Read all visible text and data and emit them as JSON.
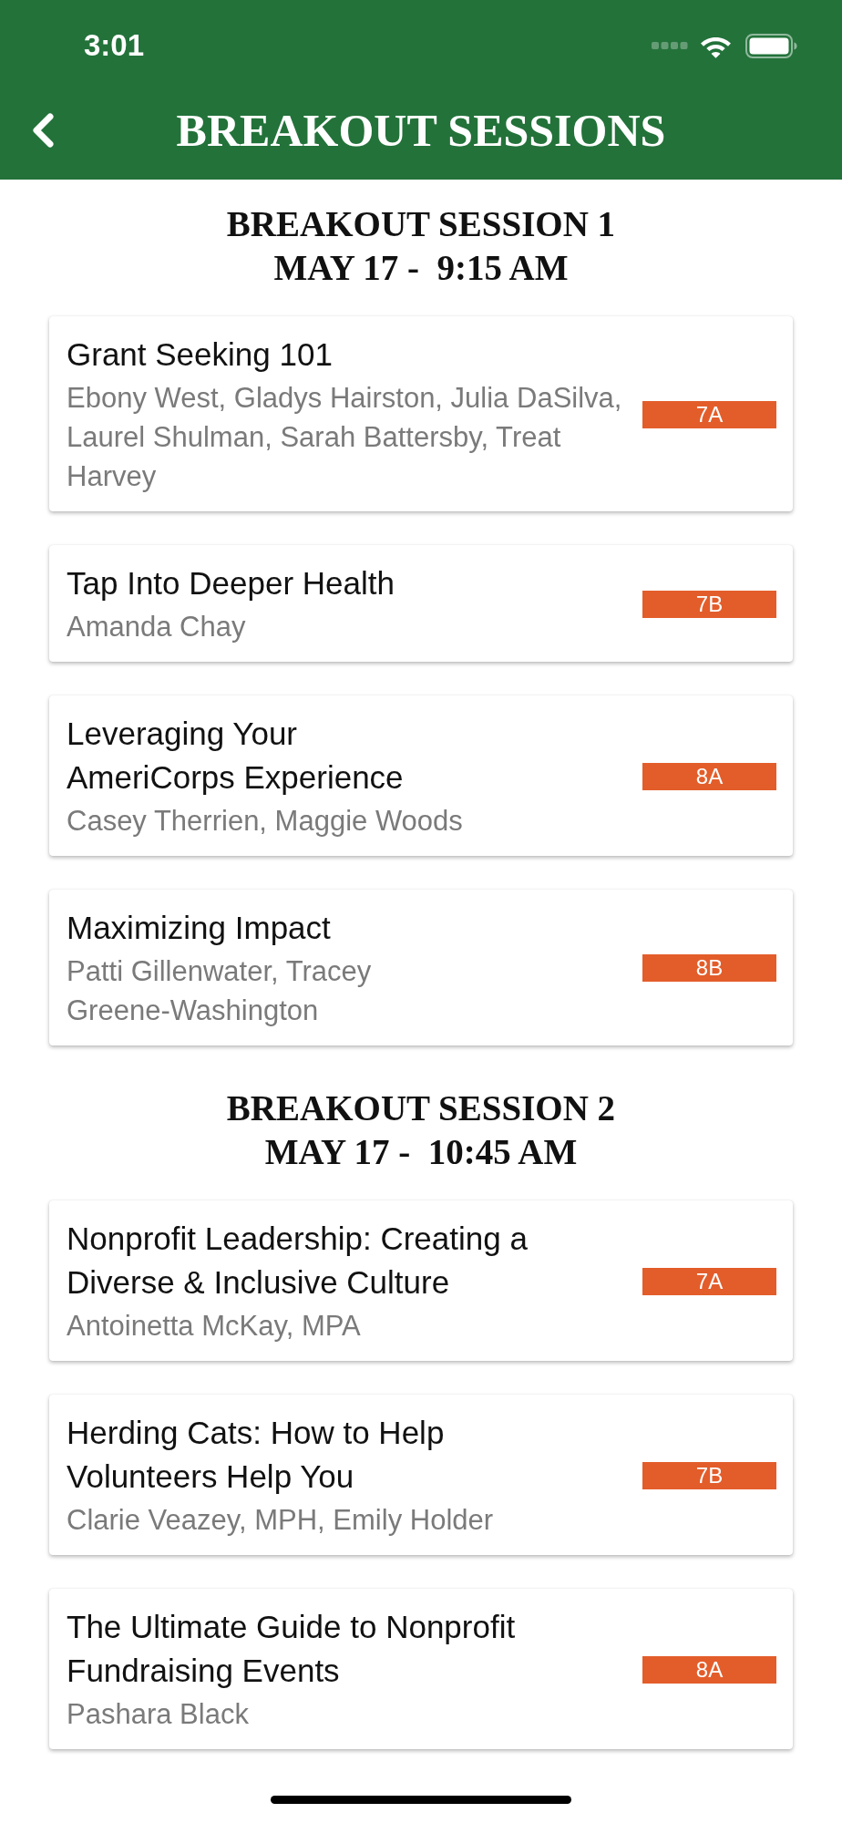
{
  "status_bar": {
    "time": "3:01"
  },
  "nav_bar": {
    "title": "BREAKOUT SESSIONS"
  },
  "sections": [
    {
      "title": "BREAKOUT SESSION 1",
      "time": "MAY 17 -  9:15 AM",
      "sessions": [
        {
          "title": "Grant Seeking 101",
          "speakers": "Ebony West, Gladys Hairston, Julia DaSilva, Laurel Shulman, Sarah Battersby, Treat Harvey",
          "room": "7A"
        },
        {
          "title": "Tap Into Deeper Health",
          "speakers": "Amanda Chay",
          "room": "7B"
        },
        {
          "title": "Leveraging Your\nAmeriCorps Experience",
          "speakers": "Casey Therrien, Maggie Woods",
          "room": "8A"
        },
        {
          "title": "Maximizing Impact",
          "speakers": "Patti Gillenwater, Tracey Greene-Washington",
          "room": "8B"
        }
      ]
    },
    {
      "title": "BREAKOUT SESSION 2",
      "time": "MAY 17 -  10:45 AM",
      "sessions": [
        {
          "title": "Nonprofit Leadership: Creating a\nDiverse & Inclusive Culture",
          "speakers": "Antoinetta McKay, MPA",
          "room": "7A"
        },
        {
          "title": "Herding Cats: How to Help\nVolunteers Help You",
          "speakers": "Clarie Veazey, MPH, Emily Holder",
          "room": "7B"
        },
        {
          "title": "The Ultimate Guide to Nonprofit\nFundraising Events",
          "speakers": "Pashara Black",
          "room": "8A"
        }
      ]
    }
  ]
}
